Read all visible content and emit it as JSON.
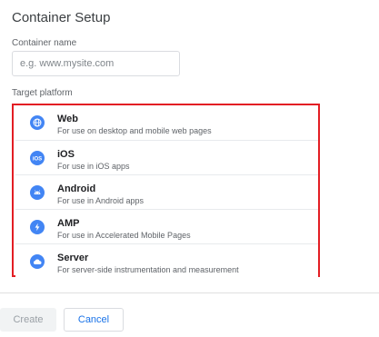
{
  "dialog": {
    "title": "Container Setup"
  },
  "container_name": {
    "label": "Container name",
    "placeholder": "e.g. www.mysite.com",
    "value": ""
  },
  "target_platform": {
    "label": "Target platform",
    "highlight_color": "#e31e24",
    "items": [
      {
        "name": "Web",
        "description": "For use on desktop and mobile web pages",
        "icon": "globe-icon"
      },
      {
        "name": "iOS",
        "description": "For use in iOS apps",
        "icon": "ios-icon"
      },
      {
        "name": "Android",
        "description": "For use in Android apps",
        "icon": "android-icon"
      },
      {
        "name": "AMP",
        "description": "For use in Accelerated Mobile Pages",
        "icon": "lightning-bolt-icon"
      },
      {
        "name": "Server",
        "description": "For server-side instrumentation and measurement",
        "icon": "cloud-icon"
      }
    ]
  },
  "actions": {
    "create_label": "Create",
    "cancel_label": "Cancel"
  },
  "colors": {
    "icon_blue": "#4285f4",
    "link_blue": "#1a73e8"
  }
}
